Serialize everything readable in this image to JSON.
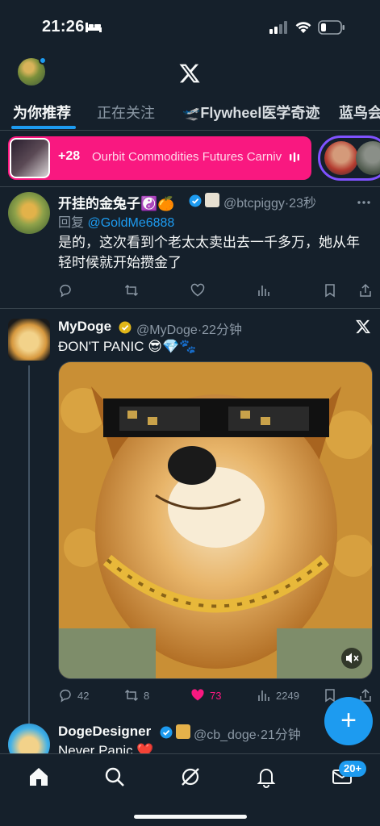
{
  "status_bar": {
    "time": "21:26"
  },
  "header": {
    "logo": "x-logo-icon"
  },
  "tabs": [
    {
      "label": "为你推荐",
      "active": true
    },
    {
      "label": "正在关注",
      "active": false
    },
    {
      "label": "🛫Flywheel医学奇迹",
      "active": false
    },
    {
      "label": "蓝鸟会",
      "active": false
    }
  ],
  "spaces": {
    "listener_count": "+28",
    "title": "Ourbit Commodities Futures Carniv"
  },
  "tweets": [
    {
      "name": "开挂的金兔子☯️🍊",
      "handle": "@btcpiggy",
      "time": "·23秒",
      "reply_prefix": "回复 ",
      "reply_to": "@GoldMe6888",
      "text": "是的，这次看到个老太太卖出去一千多万，她从年轻时候就开始攒金了",
      "stats": {
        "replies": "",
        "reposts": "",
        "likes": "",
        "views": ""
      }
    },
    {
      "name": "MyDoge",
      "handle": "@MyDoge",
      "time": "·22分钟",
      "text": "ÐON'T PANIC 😎💎🐾",
      "stats": {
        "replies": "42",
        "reposts": "8",
        "likes": "73",
        "views": "2249"
      },
      "liked": true
    },
    {
      "name": "DogeDesigner",
      "handle": "@cb_doge",
      "time": "·21分钟",
      "text": "Never Panic ❤️"
    }
  ],
  "bottom_nav": {
    "items": [
      "home-icon",
      "search-icon",
      "grok-icon",
      "notifications-icon",
      "messages-icon"
    ],
    "messages_badge": "20+"
  },
  "colors": {
    "background": "#15202b",
    "accent": "#1d9bf0",
    "like": "#f91880",
    "muted": "#8b98a5"
  }
}
